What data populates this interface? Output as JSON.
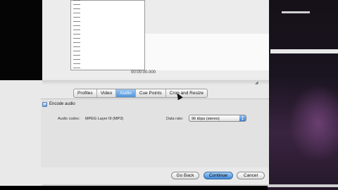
{
  "timeline": {
    "timecode": "00:00:00.000"
  },
  "tabs": [
    {
      "label": "Profiles",
      "active": false
    },
    {
      "label": "Video",
      "active": false
    },
    {
      "label": "Audio",
      "active": true
    },
    {
      "label": "Cue Points",
      "active": false
    },
    {
      "label": "Crop and Resize",
      "active": false
    }
  ],
  "audio": {
    "encode_checkbox_label": "Encode audio",
    "encode_checked": true,
    "codec_label": "Audio codec:",
    "codec_value": "MPEG Layer III (MP3)",
    "data_rate_label": "Data rate:",
    "data_rate_value": "96 kbps (stereo)"
  },
  "buttons": {
    "back": "Go Back",
    "continue": "Continue",
    "cancel": "Cancel"
  },
  "colors": {
    "accent": "#4e93d8",
    "dialog_bg": "#e9e9e9"
  }
}
